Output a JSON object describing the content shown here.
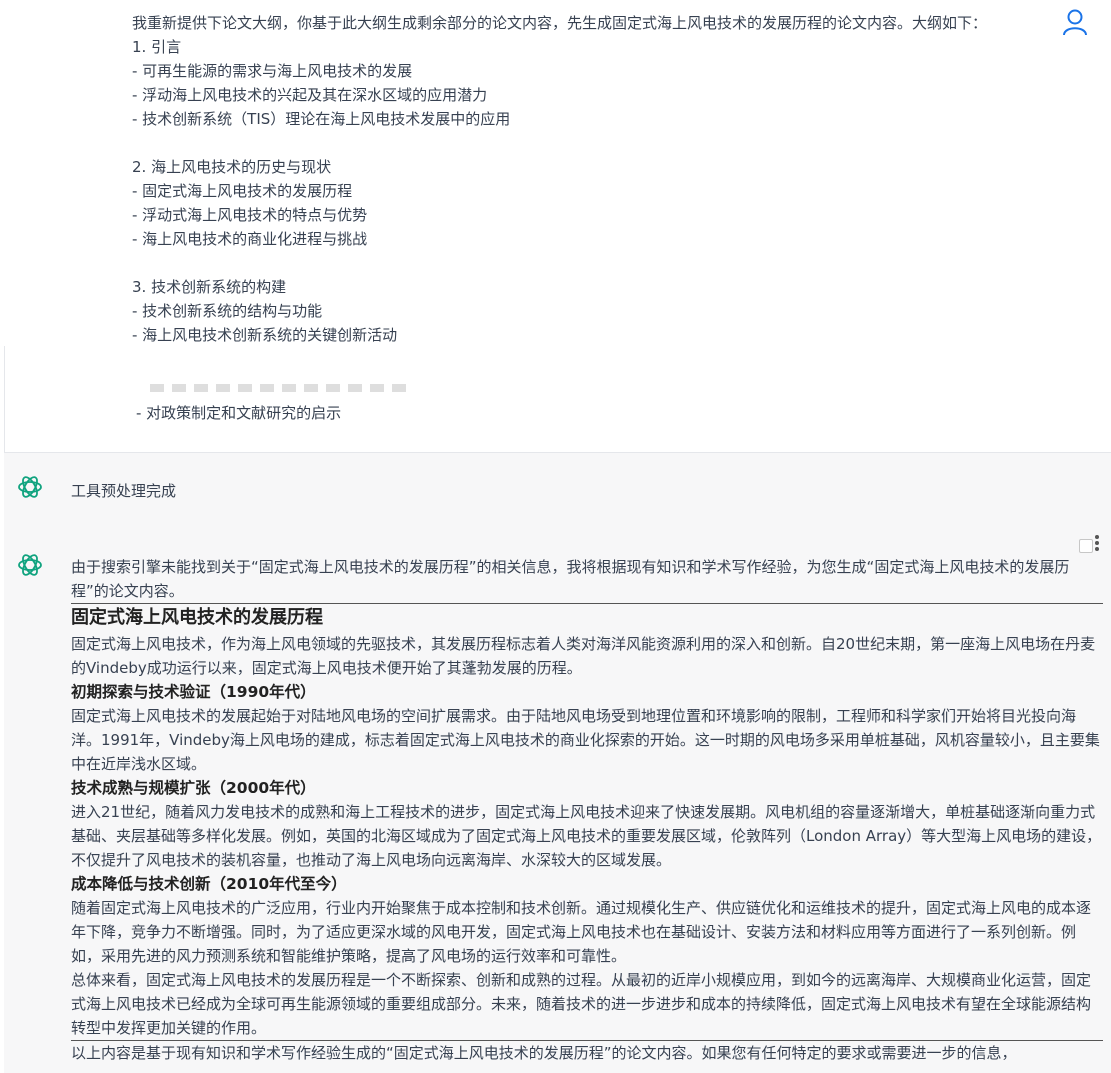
{
  "user_message": {
    "lines": [
      "我重新提供下论文大纲，你基于此大纲生成剩余部分的论文内容，先生成固定式海上风电技术的发展历程的论文内容。大纲如下：",
      "1. 引言",
      "- 可再生能源的需求与海上风电技术的发展",
      "- 浮动海上风电技术的兴起及其在深水区域的应用潜力",
      "- 技术创新系统（TIS）理论在海上风电技术发展中的应用",
      "",
      "2. 海上风电技术的历史与现状",
      "- 固定式海上风电技术的发展历程",
      "- 浮动式海上风电技术的特点与优势",
      "- 海上风电技术的商业化进程与挑战",
      "",
      "3. 技术创新系统的构建",
      "- 技术创新系统的结构与功能",
      "- 海上风电技术创新系统的关键创新活动"
    ],
    "tail_line": "- 对政策制定和文献研究的启示",
    "avatar_icon": "user-icon"
  },
  "tool_message": {
    "text": "工具预处理完成",
    "icon": "chatgpt-logo-icon"
  },
  "answer": {
    "icon": "chatgpt-logo-icon",
    "intro": "由于搜索引擎未能找到关于“固定式海上风电技术的发展历程”的相关信息，我将根据现有知识和学术写作经验，为您生成“固定式海上风电技术的发展历程”的论文内容。",
    "title": "固定式海上风电技术的发展历程",
    "lead": "固定式海上风电技术，作为海上风电领域的先驱技术，其发展历程标志着人类对海洋风能资源利用的深入和创新。自20世纪末期，第一座海上风电场在丹麦的Vindeby成功运行以来，固定式海上风电技术便开始了其蓬勃发展的历程。",
    "sections": [
      {
        "heading": "初期探索与技术验证（1990年代）",
        "text": "固定式海上风电技术的发展起始于对陆地风电场的空间扩展需求。由于陆地风电场受到地理位置和环境影响的限制，工程师和科学家们开始将目光投向海洋。1991年，Vindeby海上风电场的建成，标志着固定式海上风电技术的商业化探索的开始。这一时期的风电场多采用单桩基础，风机容量较小，且主要集中在近岸浅水区域。"
      },
      {
        "heading": "技术成熟与规模扩张（2000年代）",
        "text": "进入21世纪，随着风力发电技术的成熟和海上工程技术的进步，固定式海上风电技术迎来了快速发展期。风电机组的容量逐渐增大，单桩基础逐渐向重力式基础、夹层基础等多样化发展。例如，英国的北海区域成为了固定式海上风电技术的重要发展区域，伦敦阵列（London Array）等大型海上风电场的建设，不仅提升了风电技术的装机容量，也推动了海上风电场向远离海岸、水深较大的区域发展。"
      },
      {
        "heading": "成本降低与技术创新（2010年代至今）",
        "text": "随着固定式海上风电技术的广泛应用，行业内开始聚焦于成本控制和技术创新。通过规模化生产、供应链优化和运维技术的提升，固定式海上风电的成本逐年下降，竞争力不断增强。同时，为了适应更深水域的风电开发，固定式海上风电技术也在基础设计、安装方法和材料应用等方面进行了一系列创新。例如，采用先进的风力预测系统和智能维护策略，提高了风电场的运行效率和可靠性。"
      }
    ],
    "conclusion": "总体来看，固定式海上风电技术的发展历程是一个不断探索、创新和成熟的过程。从最初的近岸小规模应用，到如今的远离海岸、大规模商业化运营，固定式海上风电技术已经成为全球可再生能源领域的重要组成部分。未来，随着技术的进一步进步和成本的持续降低，固定式海上风电技术有望在全球能源结构转型中发挥更加关键的作用。",
    "outro": "以上内容是基于现有知识和学术写作经验生成的“固定式海上风电技术的发展历程”的论文内容。如果您有任何特定的要求或需要进一步的信息，",
    "more_icon": "more-vertical-icon",
    "checkbox_icon": "checkbox-icon"
  },
  "colors": {
    "accent": "#1a73e8",
    "chatgpt": "#10a37f",
    "assistant_bg": "#f7f7f8"
  }
}
